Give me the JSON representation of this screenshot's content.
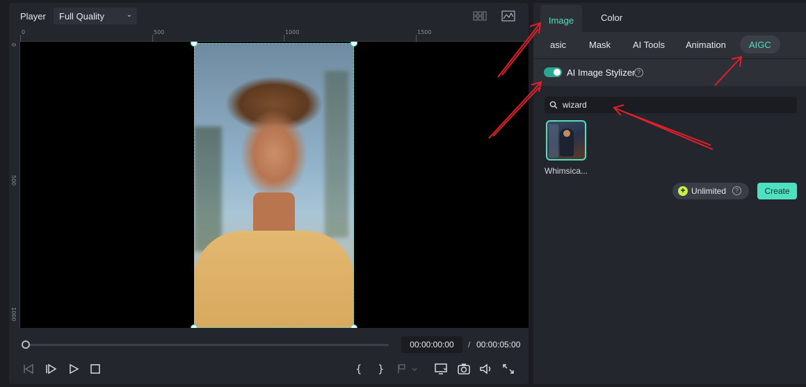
{
  "player": {
    "title": "Player",
    "quality": "Full Quality",
    "ruler_top": [
      "0",
      "500",
      "1000",
      "1500"
    ],
    "ruler_left": [
      "0",
      "500",
      "1000"
    ],
    "time_current": "00:00:00:00",
    "time_separator": "/",
    "time_total": "00:00:05:00",
    "playhead_fraction": 0
  },
  "panel": {
    "tabs": {
      "image": "Image",
      "color": "Color"
    },
    "subtabs": {
      "basic": "asic",
      "mask": "Mask",
      "ai_tools": "AI Tools",
      "animation": "Animation",
      "aigc": "AIGC"
    },
    "section_title": "AI Image Stylizer",
    "section_enabled": true,
    "search_value": "wizard",
    "result_label": "Whimsica...",
    "credits_label": "Unlimited",
    "create_label": "Create"
  },
  "colors": {
    "accent": "#4fe0c2",
    "annotation_arrow": "#e0202a",
    "credit_icon": "#c7f04a"
  }
}
